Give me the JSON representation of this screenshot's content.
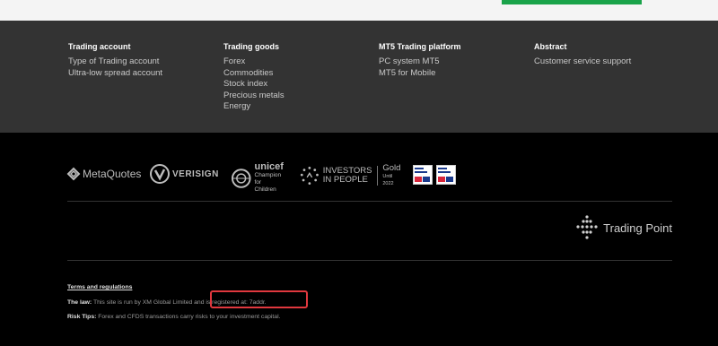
{
  "nav": {
    "columns": [
      {
        "title": "Trading account",
        "items": [
          "Type of Trading account",
          "Ultra-low spread account"
        ]
      },
      {
        "title": "Trading goods",
        "items": [
          "Forex",
          "Commodities",
          "Stock index",
          "Precious metals",
          "Energy"
        ]
      },
      {
        "title": "MT5 Trading platform",
        "items": [
          "PC system MT5",
          "MT5 for Mobile"
        ]
      },
      {
        "title": "Abstract",
        "items": [
          "Customer service support"
        ]
      }
    ]
  },
  "partners": {
    "metaquotes": "MetaQuotes",
    "verisign": "VERISIGN",
    "unicef_name": "unicef",
    "unicef_tag1": "Champion",
    "unicef_tag2": "for Children",
    "iip_line1": "INVESTORS",
    "iip_line2": "IN PEOPLE",
    "iip_gold": "Gold",
    "iip_until": "Until 2022"
  },
  "brand": {
    "trading_point": "Trading Point"
  },
  "legal": {
    "terms_label": "Terms and regulations",
    "law_label": "The law:",
    "law_text": "This site is run by XM Global Limited and is registered at: 7addr.",
    "risk_label": "Risk Tips:",
    "risk_text": "Forex and CFDS transactions carry risks to your investment capital."
  },
  "colors": {
    "accent_green": "#1aa34a",
    "highlight_red": "#e0383e",
    "nav_bg": "#333333"
  }
}
